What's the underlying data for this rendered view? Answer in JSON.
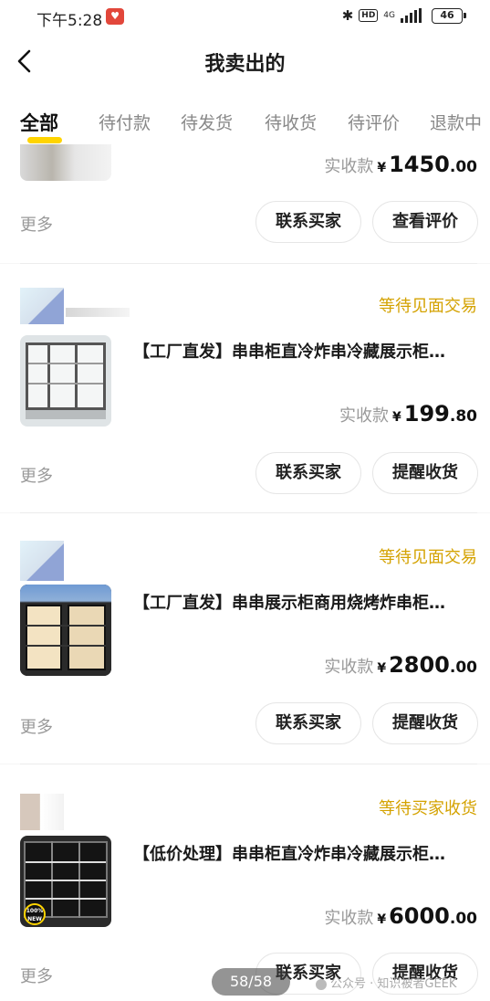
{
  "status_bar": {
    "time": "下午5:28",
    "app_icon_glyph": "♥",
    "hd": "HD",
    "network": "4G",
    "battery": "46"
  },
  "header": {
    "title": "我卖出的"
  },
  "tabs": [
    {
      "label": "全部",
      "active": true
    },
    {
      "label": "待付款"
    },
    {
      "label": "待发货"
    },
    {
      "label": "待收货"
    },
    {
      "label": "待评价"
    },
    {
      "label": "退款中"
    }
  ],
  "orders": [
    {
      "price_label": "实收款",
      "currency": "¥",
      "price_int": "1450",
      "price_dec": ".00",
      "more": "更多",
      "btn_contact": "联系买家",
      "btn_second": "查看评价"
    },
    {
      "status": "等待见面交易",
      "title": "【工厂直发】串串柜直冷炸串冷藏展示柜…",
      "price_label": "实收款",
      "currency": "¥",
      "price_int": "199",
      "price_dec": ".80",
      "more": "更多",
      "btn_contact": "联系买家",
      "btn_second": "提醒收货"
    },
    {
      "status": "等待见面交易",
      "title": "【工厂直发】串串展示柜商用烧烤炸串柜…",
      "price_label": "实收款",
      "currency": "¥",
      "price_int": "2800",
      "price_dec": ".00",
      "more": "更多",
      "btn_contact": "联系买家",
      "btn_second": "提醒收货"
    },
    {
      "status": "等待买家收货",
      "title": "【低价处理】串串柜直冷炸串冷藏展示柜…",
      "badge": "100% NEW",
      "price_label": "实收款",
      "currency": "¥",
      "price_int": "6000",
      "price_dec": ".00",
      "more": "更多",
      "btn_contact": "联系买家",
      "btn_second": "提醒收货"
    }
  ],
  "overlay": {
    "page_indicator": "58/58",
    "watermark": "公众号 · 知识被者GEEK"
  },
  "colors": {
    "accent": "#ffd400",
    "status_text": "#d4a200"
  }
}
